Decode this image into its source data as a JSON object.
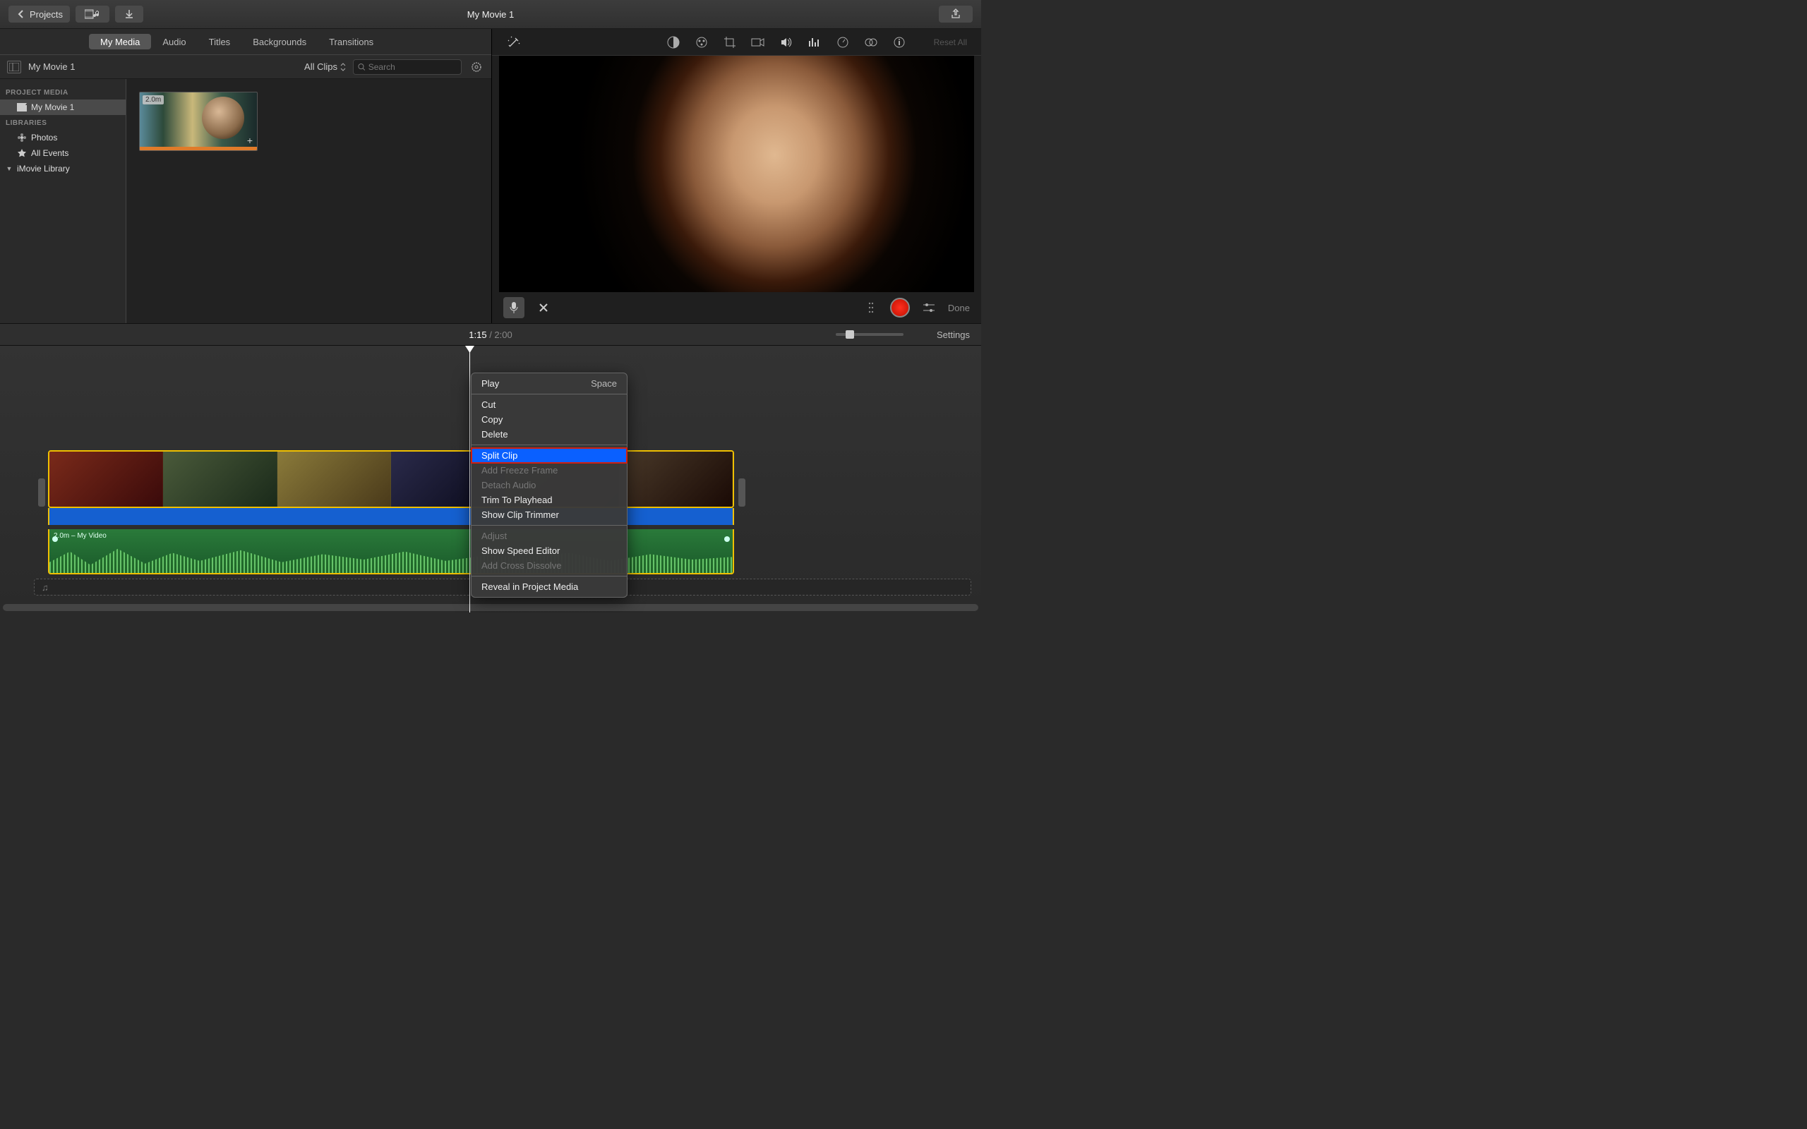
{
  "toolbar": {
    "projects_label": "Projects",
    "title": "My Movie 1"
  },
  "tabs": {
    "my_media": "My Media",
    "audio": "Audio",
    "titles": "Titles",
    "backgrounds": "Backgrounds",
    "transitions": "Transitions"
  },
  "browser": {
    "breadcrumb": "My Movie 1",
    "clips_filter": "All Clips",
    "search_placeholder": "Search"
  },
  "sidebar": {
    "heading_project": "PROJECT MEDIA",
    "project_item": "My Movie 1",
    "heading_libraries": "LIBRARIES",
    "photos": "Photos",
    "all_events": "All Events",
    "imovie_library": "iMovie Library"
  },
  "clip": {
    "duration_badge": "2.0m"
  },
  "adjust": {
    "reset_all": "Reset All"
  },
  "viewer": {
    "done": "Done"
  },
  "timebar": {
    "current": "1:15",
    "separator": " / ",
    "total": "2:00",
    "settings": "Settings"
  },
  "timeline": {
    "audio_label": "2.0m – My Video"
  },
  "context_menu": {
    "play": "Play",
    "play_shortcut": "Space",
    "cut": "Cut",
    "copy": "Copy",
    "delete": "Delete",
    "split_clip": "Split Clip",
    "add_freeze_frame": "Add Freeze Frame",
    "detach_audio": "Detach Audio",
    "trim_to_playhead": "Trim To Playhead",
    "show_clip_trimmer": "Show Clip Trimmer",
    "adjust": "Adjust",
    "show_speed_editor": "Show Speed Editor",
    "add_cross_dissolve": "Add Cross Dissolve",
    "reveal_in_project_media": "Reveal in Project Media"
  }
}
